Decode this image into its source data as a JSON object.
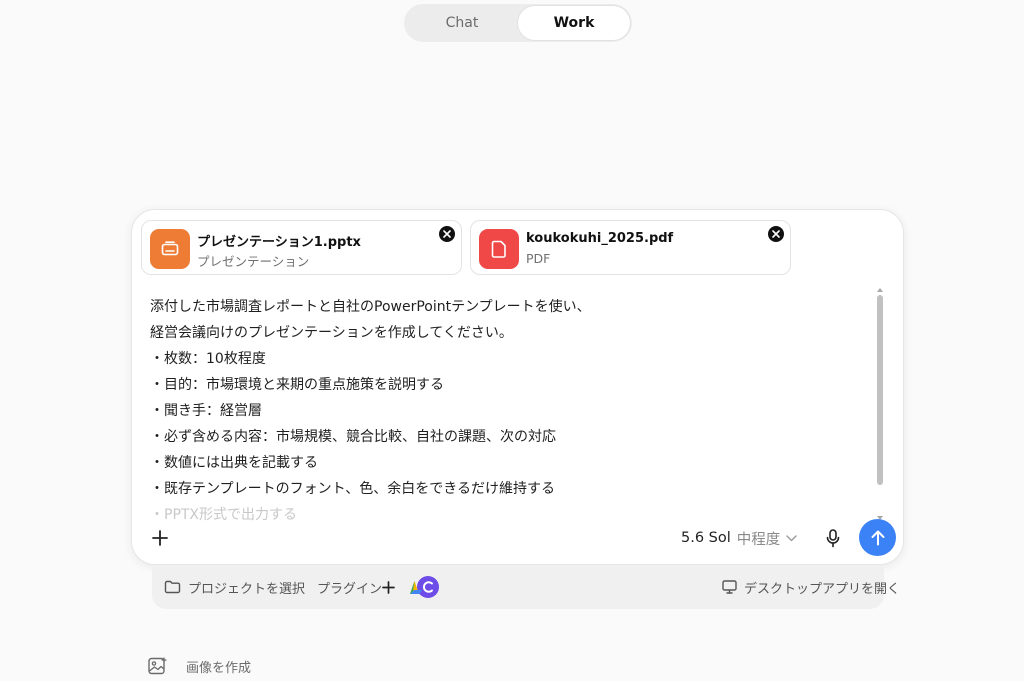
{
  "mode_toggle": {
    "tabs": [
      {
        "label": "Chat",
        "active": false
      },
      {
        "label": "Work",
        "active": true
      }
    ]
  },
  "attachments": [
    {
      "name": "プレゼンテーション1.pptx",
      "type": "プレゼンテーション",
      "icon": "presentation-icon",
      "color": "#ef7c35"
    },
    {
      "name": "koukokuhi_2025.pdf",
      "type": "PDF",
      "icon": "pdf-file-icon",
      "color": "#f04747"
    }
  ],
  "prompt": {
    "lines": [
      "添付した市場調査レポートと自社のPowerPointテンプレートを使い、",
      "経営会議向けのプレゼンテーションを作成してください。",
      "・枚数：10枚程度",
      "・目的：市場環境と来期の重点施策を説明する",
      "・聞き手：経営層",
      "・必ず含める内容：市場規模、競合比較、自社の課題、次の対応",
      "・数値には出典を記載する",
      "・既存テンプレートのフォント、色、余白をできるだけ維持する",
      "・PPTX形式で出力する"
    ]
  },
  "composer_controls": {
    "model_name": "5.6 Sol",
    "model_effort": "中程度",
    "send_color": "#3b82f6"
  },
  "tray": {
    "project_label": "プロジェクトを選択",
    "plugin_label": "プラグイン",
    "desktop_label": "デスクトップアプリを開く"
  },
  "image_create": {
    "label": "画像を作成"
  }
}
